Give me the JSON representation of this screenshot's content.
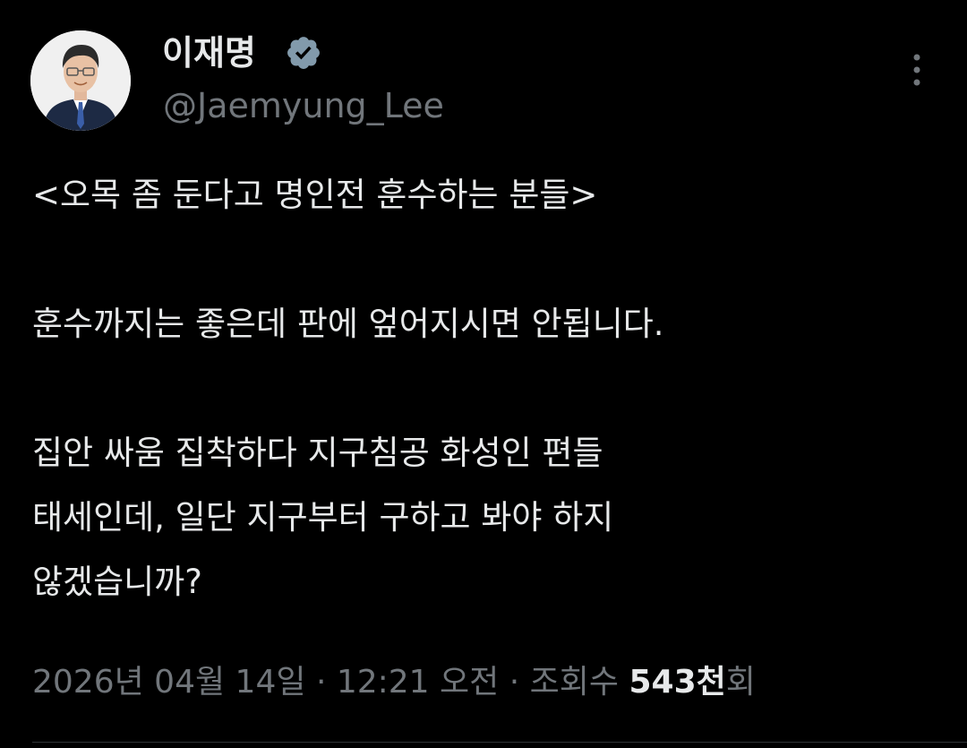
{
  "author": {
    "display_name": "이재명",
    "handle": "@Jaemyung_Lee",
    "verified": true,
    "avatar_icon": "profile-photo"
  },
  "tweet": {
    "lines": [
      "<오목 좀 둔다고 명인전 훈수하는 분들>",
      "",
      "훈수까지는 좋은데 판에 엎어지시면 안됩니다.",
      "",
      "집안 싸움 집착하다 지구침공 화성인 편들",
      "태세인데, 일단 지구부터 구하고 봐야 하지",
      "않겠습니까?"
    ]
  },
  "meta": {
    "date": "2026년 04월 14일",
    "separator": "·",
    "time": "12:21 오전",
    "views_label": "조회수",
    "views_count": "543천",
    "views_suffix": "회"
  },
  "icons": {
    "verified": "verified-badge-icon",
    "more": "more-options-icon"
  },
  "colors": {
    "background": "#000000",
    "primary_text": "#e7e9ea",
    "secondary_text": "#71767b",
    "badge": "#829aab"
  }
}
